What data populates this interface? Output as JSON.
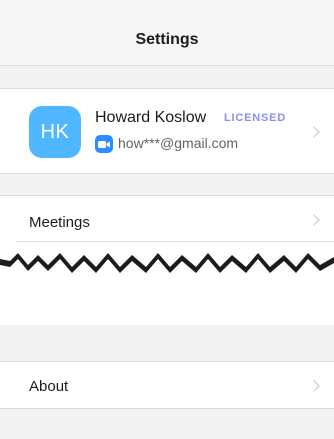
{
  "header": {
    "title": "Settings"
  },
  "profile": {
    "initials": "HK",
    "name": "Howard Koslow",
    "badge": "LICENSED",
    "email": "how***@gmail.com"
  },
  "menu": {
    "meetings": "Meetings",
    "about": "About"
  },
  "colors": {
    "background": "#f2f2f4",
    "avatar": "#4fb7ff",
    "badge": "#8c8fe8",
    "video_icon": "#2d8cff"
  }
}
